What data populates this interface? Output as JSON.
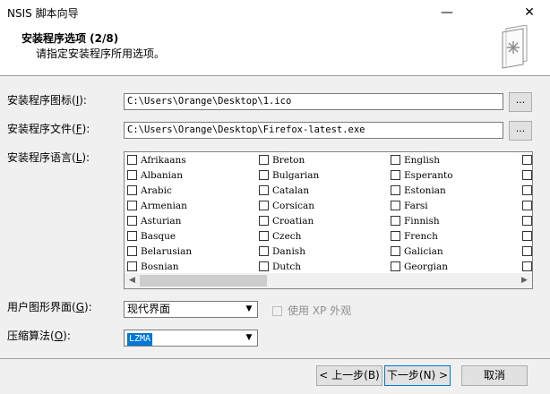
{
  "window": {
    "title": "NSIS 脚本向导",
    "minimize_glyph": "—",
    "close_glyph": "✕"
  },
  "header": {
    "title": "安装程序选项 (2/8)",
    "subtitle": "请指定安装程序所用选项。",
    "icon": "wizard-book-icon"
  },
  "fields": {
    "icon_label": "安装程序图标(",
    "icon_key": "I",
    "icon_label_end": "):",
    "icon_value": "C:\\Users\\Orange\\Desktop\\1.ico",
    "file_label": "安装程序文件(",
    "file_key": "F",
    "file_label_end": "):",
    "file_value": "C:\\Users\\Orange\\Desktop\\Firefox-latest.exe",
    "browse_label": "...",
    "lang_label": "安装程序语言(",
    "lang_key": "L",
    "lang_label_end": "):"
  },
  "languages": {
    "col1": [
      "Afrikaans",
      "Albanian",
      "Arabic",
      "Armenian",
      "Asturian",
      "Basque",
      "Belarusian",
      "Bosnian"
    ],
    "col2": [
      "Breton",
      "Bulgarian",
      "Catalan",
      "Corsican",
      "Croatian",
      "Czech",
      "Danish",
      "Dutch"
    ],
    "col3": [
      "English",
      "Esperanto",
      "Estonian",
      "Farsi",
      "Finnish",
      "French",
      "Galician",
      "Georgian"
    ]
  },
  "ui": {
    "label": "用户图形界面(",
    "key": "G",
    "label_end": "):",
    "value": "现代界面",
    "xp_label": "使用 XP 外观"
  },
  "compression": {
    "label": "压缩算法(",
    "key": "O",
    "label_end": "):",
    "value": "LZMA"
  },
  "buttons": {
    "back": "< 上一步(B)",
    "next": "下一步(N) >",
    "cancel": "取消"
  },
  "colors": {
    "accent": "#0078d7",
    "background": "#f0f0f0"
  }
}
